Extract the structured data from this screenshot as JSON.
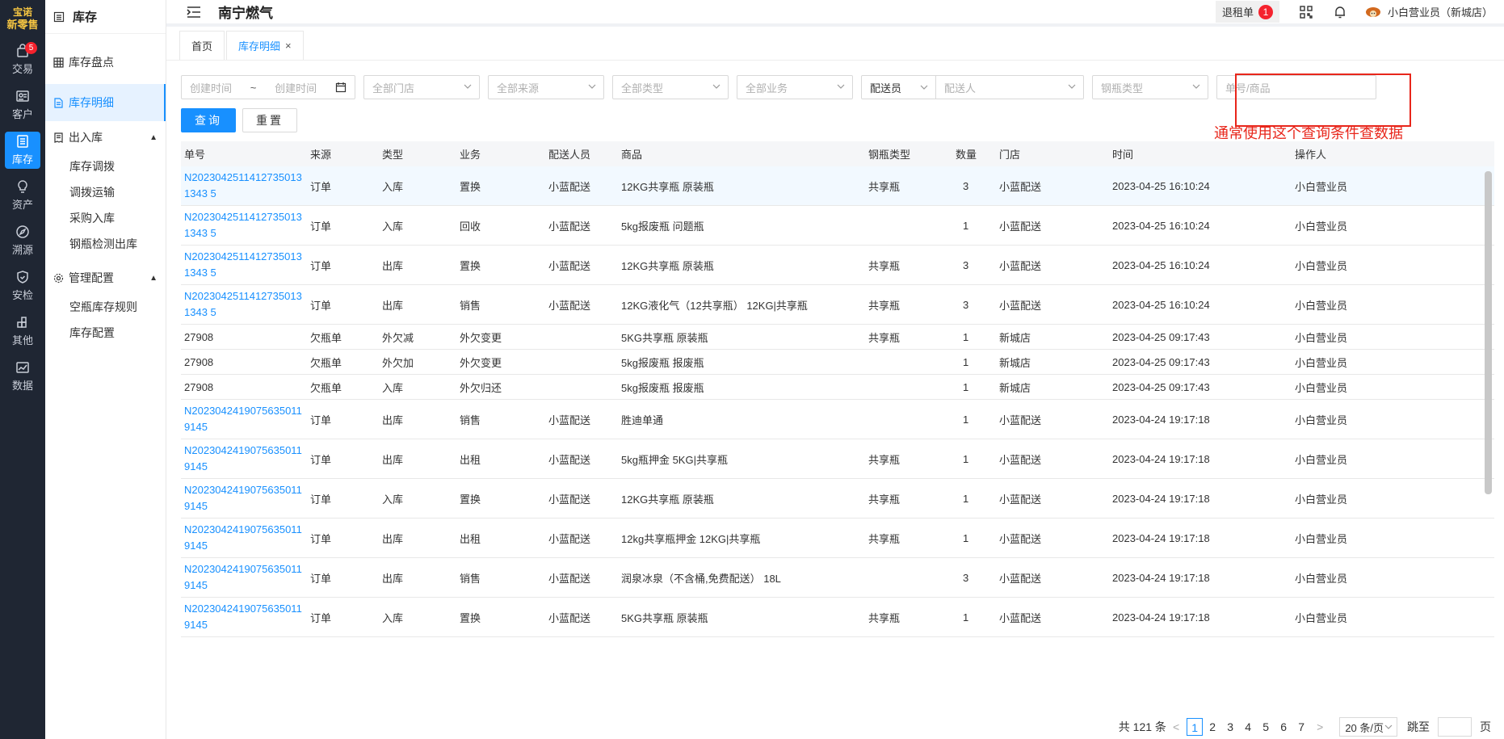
{
  "rail": {
    "logo_top": "宝诺",
    "logo_bottom": "新零售",
    "items": [
      {
        "label": "交易",
        "badge": "5"
      },
      {
        "label": "客户"
      },
      {
        "label": "库存"
      },
      {
        "label": "资产"
      },
      {
        "label": "溯源"
      },
      {
        "label": "安检"
      },
      {
        "label": "其他"
      },
      {
        "label": "数据"
      }
    ]
  },
  "sidebar": {
    "title": "库存",
    "items": [
      "库存盘点",
      "库存明细"
    ],
    "group1": "出入库",
    "group1_items": [
      "库存调拨",
      "调拨运输",
      "采购入库",
      "钢瓶检测出库"
    ],
    "group2": "管理配置",
    "group2_items": [
      "空瓶库存规则",
      "库存配置"
    ]
  },
  "topbar": {
    "brand": "南宁燃气",
    "refund_label": "退租单",
    "refund_count": "1",
    "user": "小白营业员（新城店）"
  },
  "tabs": [
    {
      "label": "首页"
    },
    {
      "label": "库存明细",
      "close": "×"
    }
  ],
  "filters": {
    "start_ph": "创建时间",
    "sep": "~",
    "end_ph": "创建时间",
    "store_ph": "全部门店",
    "source_ph": "全部来源",
    "type_ph": "全部类型",
    "business_ph": "全部业务",
    "combo_left": "配送员",
    "combo_right_ph": "配送人",
    "cylinder_ph": "钢瓶类型",
    "order_ph": "单号/商品",
    "query_btn": "查询",
    "reset_btn": "重置"
  },
  "annotation": "通常使用这个查询条件查数据",
  "table": {
    "headers": [
      "单号",
      "来源",
      "类型",
      "业务",
      "配送人员",
      "商品",
      "钢瓶类型",
      "数量",
      "门店",
      "时间",
      "操作人"
    ],
    "rows": [
      {
        "no": "N20230425114127350131343 5",
        "src": "订单",
        "type": "入库",
        "biz": "置换",
        "courier": "小蓝配送",
        "goods": "12KG共享瓶 原装瓶",
        "cyl": "共享瓶",
        "qty": "3",
        "store": "小蓝配送",
        "time": "2023-04-25 16:10:24",
        "op": "小白营业员"
      },
      {
        "no": "N20230425114127350131343 5",
        "src": "订单",
        "type": "入库",
        "biz": "回收",
        "courier": "小蓝配送",
        "goods": "5kg报废瓶 问题瓶",
        "cyl": "",
        "qty": "1",
        "store": "小蓝配送",
        "time": "2023-04-25 16:10:24",
        "op": "小白营业员"
      },
      {
        "no": "N20230425114127350131343 5",
        "src": "订单",
        "type": "出库",
        "biz": "置换",
        "courier": "小蓝配送",
        "goods": "12KG共享瓶 原装瓶",
        "cyl": "共享瓶",
        "qty": "3",
        "store": "小蓝配送",
        "time": "2023-04-25 16:10:24",
        "op": "小白营业员"
      },
      {
        "no": "N20230425114127350131343 5",
        "src": "订单",
        "type": "出库",
        "biz": "销售",
        "courier": "小蓝配送",
        "goods": "12KG液化气（12共享瓶） 12KG|共享瓶",
        "cyl": "共享瓶",
        "qty": "3",
        "store": "小蓝配送",
        "time": "2023-04-25 16:10:24",
        "op": "小白营业员"
      },
      {
        "no": "27908",
        "src": "欠瓶单",
        "type": "外欠减",
        "biz": "外欠变更",
        "courier": "",
        "goods": "5KG共享瓶 原装瓶",
        "cyl": "共享瓶",
        "qty": "1",
        "store": "新城店",
        "time": "2023-04-25 09:17:43",
        "op": "小白营业员"
      },
      {
        "no": "27908",
        "src": "欠瓶单",
        "type": "外欠加",
        "biz": "外欠变更",
        "courier": "",
        "goods": "5kg报废瓶 报废瓶",
        "cyl": "",
        "qty": "1",
        "store": "新城店",
        "time": "2023-04-25 09:17:43",
        "op": "小白营业员"
      },
      {
        "no": "27908",
        "src": "欠瓶单",
        "type": "入库",
        "biz": "外欠归还",
        "courier": "",
        "goods": "5kg报废瓶 报废瓶",
        "cyl": "",
        "qty": "1",
        "store": "新城店",
        "time": "2023-04-25 09:17:43",
        "op": "小白营业员"
      },
      {
        "no": "N20230424190756350119145",
        "src": "订单",
        "type": "出库",
        "biz": "销售",
        "courier": "小蓝配送",
        "goods": "胜迪单通",
        "cyl": "",
        "qty": "1",
        "store": "小蓝配送",
        "time": "2023-04-24 19:17:18",
        "op": "小白营业员"
      },
      {
        "no": "N20230424190756350119145",
        "src": "订单",
        "type": "出库",
        "biz": "出租",
        "courier": "小蓝配送",
        "goods": "5kg瓶押金 5KG|共享瓶",
        "cyl": "共享瓶",
        "qty": "1",
        "store": "小蓝配送",
        "time": "2023-04-24 19:17:18",
        "op": "小白营业员"
      },
      {
        "no": "N20230424190756350119145",
        "src": "订单",
        "type": "入库",
        "biz": "置换",
        "courier": "小蓝配送",
        "goods": "12KG共享瓶 原装瓶",
        "cyl": "共享瓶",
        "qty": "1",
        "store": "小蓝配送",
        "time": "2023-04-24 19:17:18",
        "op": "小白营业员"
      },
      {
        "no": "N20230424190756350119145",
        "src": "订单",
        "type": "出库",
        "biz": "出租",
        "courier": "小蓝配送",
        "goods": "12kg共享瓶押金 12KG|共享瓶",
        "cyl": "共享瓶",
        "qty": "1",
        "store": "小蓝配送",
        "time": "2023-04-24 19:17:18",
        "op": "小白营业员"
      },
      {
        "no": "N20230424190756350119145",
        "src": "订单",
        "type": "出库",
        "biz": "销售",
        "courier": "小蓝配送",
        "goods": "润泉冰泉（不含桶,免费配送） 18L",
        "cyl": "",
        "qty": "3",
        "store": "小蓝配送",
        "time": "2023-04-24 19:17:18",
        "op": "小白营业员"
      },
      {
        "no": "N20230424190756350119145",
        "src": "订单",
        "type": "入库",
        "biz": "置换",
        "courier": "小蓝配送",
        "goods": "5KG共享瓶 原装瓶",
        "cyl": "共享瓶",
        "qty": "1",
        "store": "小蓝配送",
        "time": "2023-04-24 19:17:18",
        "op": "小白营业员"
      }
    ]
  },
  "pager": {
    "total": "共 121 条",
    "pages": [
      "1",
      "2",
      "3",
      "4",
      "5",
      "6",
      "7"
    ],
    "size": "20 条/页",
    "jump": "跳至",
    "page_unit": "页"
  }
}
